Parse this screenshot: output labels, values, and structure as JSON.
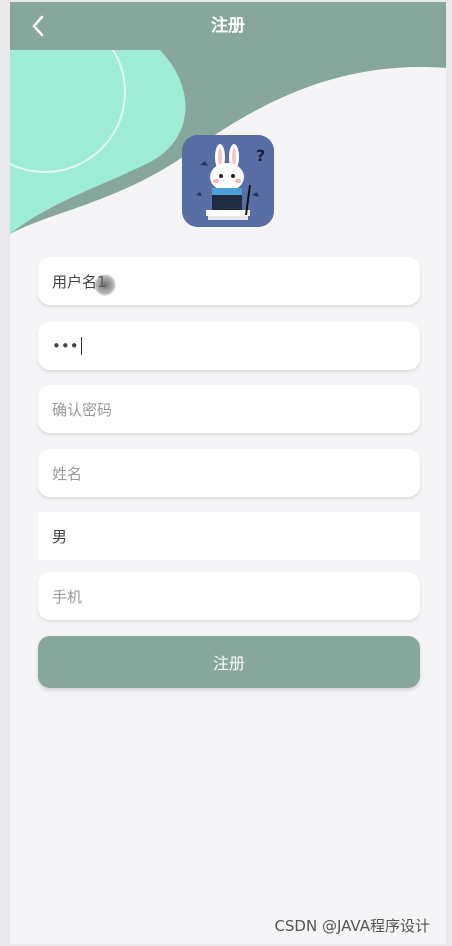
{
  "header": {
    "title": "注册"
  },
  "form": {
    "username": "用户名1",
    "password": "•••",
    "confirm_password_placeholder": "确认密码",
    "name_placeholder": "姓名",
    "gender": "男",
    "phone_placeholder": "手机"
  },
  "submit_label": "注册",
  "watermark": "CSDN @JAVA程序设计",
  "colors": {
    "header": "#87a79c",
    "accent_mint": "#9eecd6",
    "avatar_bg": "#5a6ea6",
    "page_bg": "#f5f5f8"
  }
}
